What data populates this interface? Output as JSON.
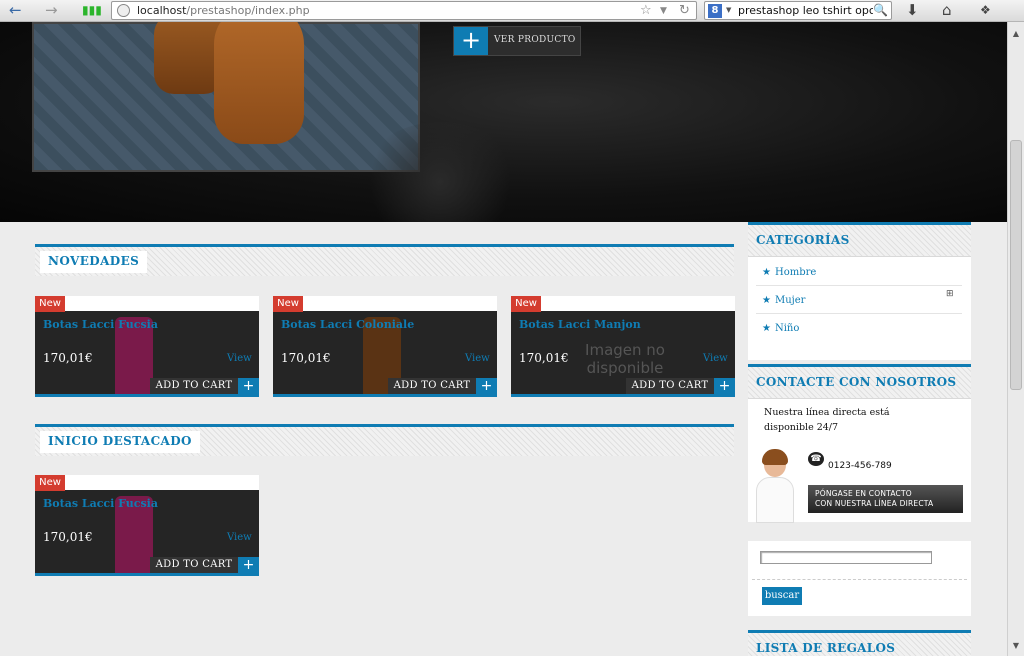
{
  "browser": {
    "url_host": "localhost",
    "url_path": "/prestashop/index.php",
    "search_query": "prestashop leo tshirt opcior",
    "search_engine_badge": "8",
    "icons": [
      "back-icon",
      "forward-icon",
      "signal-icon",
      "globe-icon",
      "star-icon",
      "reload-icon",
      "download-icon",
      "home-icon",
      "addon-icon"
    ]
  },
  "hero": {
    "button_label": "VER PRODUCTO",
    "button_icon": "+"
  },
  "sections": {
    "novedades": "NOVEDADES",
    "destacado": "INICIO DESTACADO"
  },
  "products": {
    "badge": "New",
    "view": "View",
    "add_to_cart": "ADD TO CART",
    "plus": "+",
    "no_image": "Imagen no disponible",
    "novedades": [
      {
        "name": "Botas Lacci Fucsia",
        "price": "170,01€",
        "thumb_color": "#7a1a4a"
      },
      {
        "name": "Botas Lacci Coloniale",
        "price": "170,01€",
        "thumb_color": "#5a3314"
      },
      {
        "name": "Botas Lacci Manjon",
        "price": "170,01€",
        "thumb_color": ""
      }
    ],
    "destacado": [
      {
        "name": "Botas Lacci Fucsia",
        "price": "170,01€",
        "thumb_color": "#7a1a4a"
      }
    ]
  },
  "sidebar": {
    "categorias_title": "CATEGORÍAS",
    "categories": [
      "Hombre",
      "Mujer",
      "Niño"
    ],
    "expand_icon": "⊞",
    "contact_title": "CONTACTE CON NOSOTROS",
    "contact_text": "Nuestra línea directa está disponible 24/7",
    "phone": "0123-456-789",
    "contact_button_line1": "PÓNGASE EN CONTACTO",
    "contact_button_line2": "CON NUESTRA LÍNEA DIRECTA",
    "search_button": "buscar",
    "gifts_title": "LISTA DE REGALOS"
  },
  "colors": {
    "accent": "#0f7cb3",
    "badge_red": "#d43c2f",
    "card_dark": "#252525"
  }
}
